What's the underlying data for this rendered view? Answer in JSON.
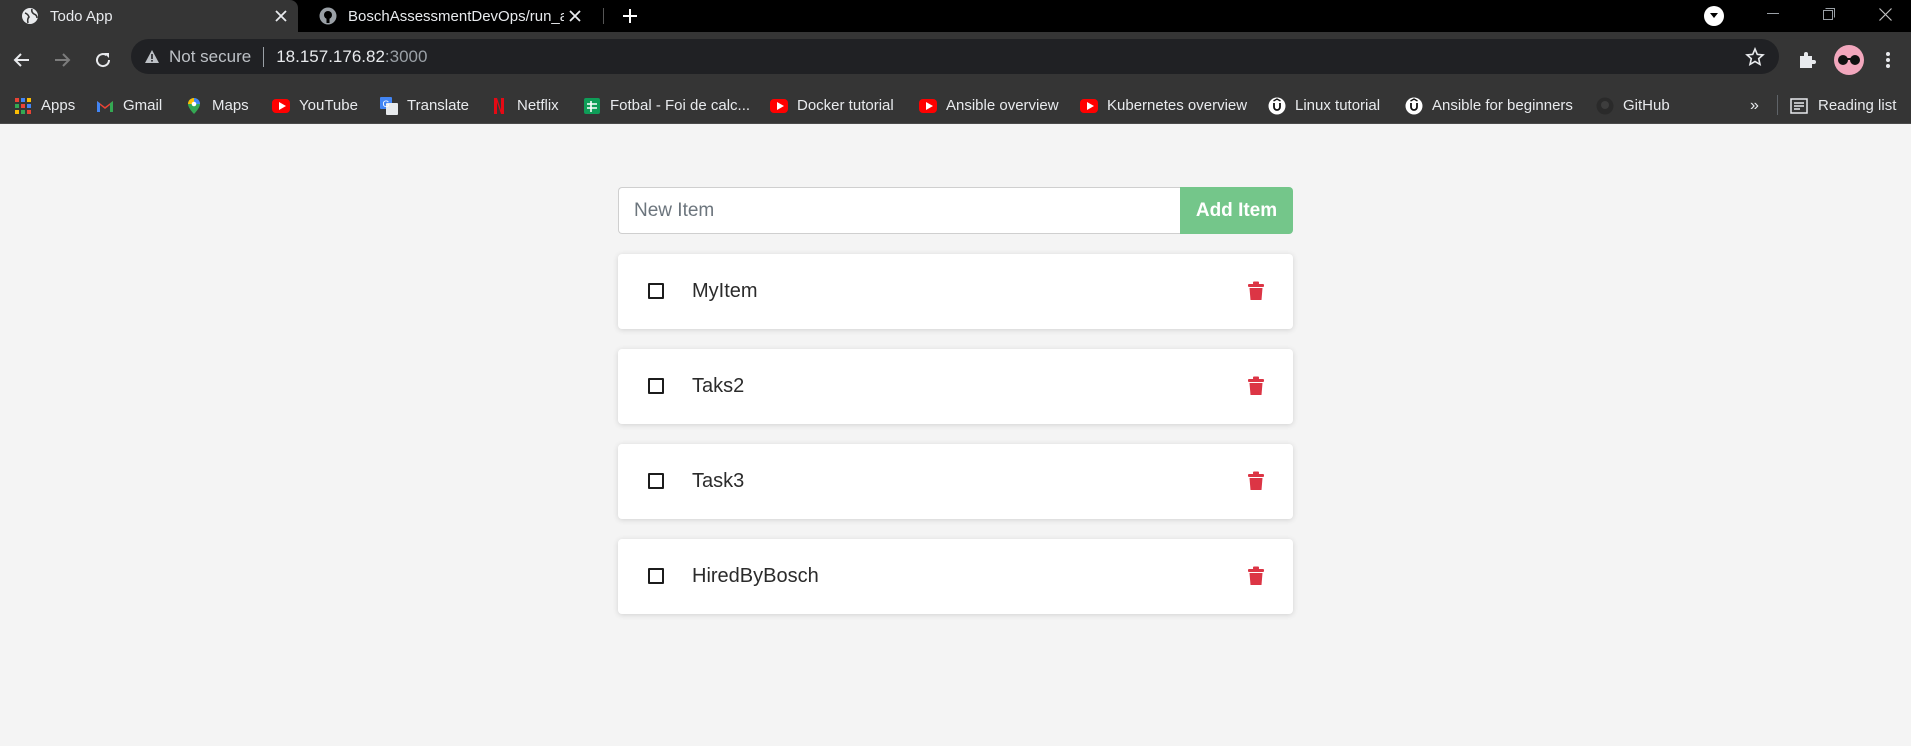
{
  "browser": {
    "tabs": [
      {
        "title": "Todo App",
        "active": true
      },
      {
        "title": "BoschAssessmentDevOps/run_ap",
        "active": false
      }
    ],
    "omnibox": {
      "security_label": "Not secure",
      "url_host": "18.157.176.82",
      "url_port": ":3000"
    },
    "bookmarks": [
      {
        "label": "Apps",
        "icon": "apps-grid-icon"
      },
      {
        "label": "Gmail",
        "icon": "gmail-icon"
      },
      {
        "label": "Maps",
        "icon": "maps-pin-icon"
      },
      {
        "label": "YouTube",
        "icon": "youtube-icon"
      },
      {
        "label": "Translate",
        "icon": "translate-icon"
      },
      {
        "label": "Netflix",
        "icon": "netflix-icon"
      },
      {
        "label": "Fotbal - Foi de calc...",
        "icon": "sheets-icon"
      },
      {
        "label": "Docker tutorial",
        "icon": "youtube-icon"
      },
      {
        "label": "Ansible overview",
        "icon": "youtube-icon"
      },
      {
        "label": "Kubernetes overview",
        "icon": "youtube-icon"
      },
      {
        "label": "Linux tutorial",
        "icon": "udemy-icon"
      },
      {
        "label": "Ansible for beginners",
        "icon": "udemy-icon"
      },
      {
        "label": "GitHub",
        "icon": "github-icon"
      }
    ],
    "more_label": "»",
    "reading_list_label": "Reading list",
    "colors": {
      "tabstrip": "#000000",
      "toolbar": "#353535",
      "omnibox": "#202124"
    }
  },
  "app": {
    "input_placeholder": "New Item",
    "input_value": "",
    "add_button_label": "Add Item",
    "items": [
      {
        "name": "MyItem",
        "completed": false
      },
      {
        "name": "Taks2",
        "completed": false
      },
      {
        "name": "Task3",
        "completed": false
      },
      {
        "name": "HiredByBosch",
        "completed": false
      }
    ],
    "colors": {
      "background": "#f4f4f4",
      "add_button": "#74c68a",
      "delete_icon": "#dc3545"
    }
  }
}
